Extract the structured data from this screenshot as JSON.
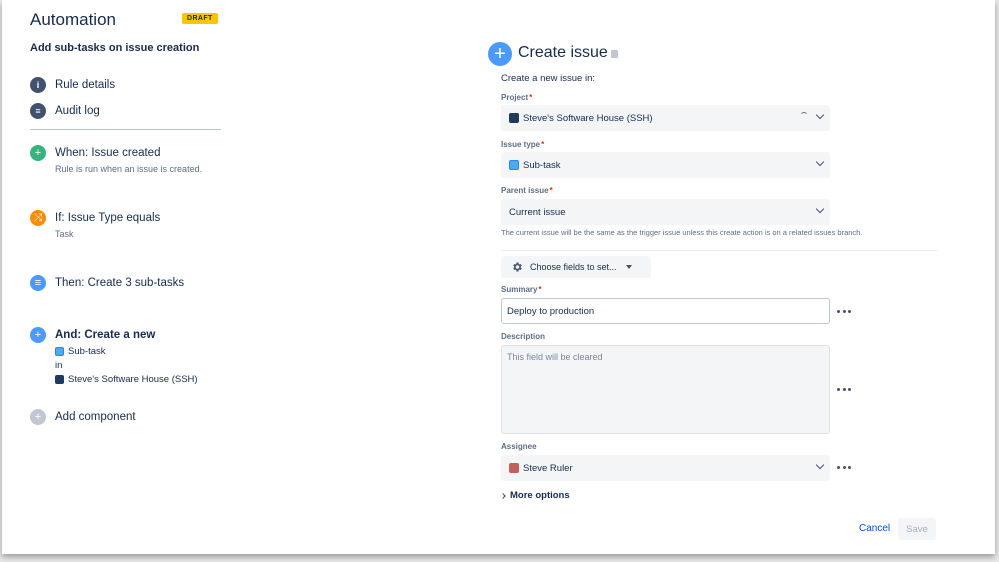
{
  "header": {
    "title": "Automation",
    "badge": "DRAFT"
  },
  "rule": {
    "name": "Add sub-tasks on issue creation"
  },
  "nav": {
    "rule_details": "Rule details",
    "audit_log": "Audit log"
  },
  "steps": {
    "when": {
      "title": "When: Issue created",
      "subtitle": "Rule is run when an issue is created."
    },
    "if": {
      "title": "If: Issue Type equals",
      "subtitle": "Task"
    },
    "then": {
      "title": "Then: Create 3 sub-tasks"
    },
    "and": {
      "title": "And: Create a new",
      "issue_type": "Sub-task",
      "in": "in",
      "project": "Steve's Software House (SSH)"
    },
    "add_component": "Add component"
  },
  "action": {
    "title": "Create issue",
    "create_in": "Create a new issue in:",
    "project": {
      "label": "Project",
      "value": "Steve's Software House (SSH)"
    },
    "issue_type": {
      "label": "Issue type",
      "value": "Sub-task"
    },
    "parent_issue": {
      "label": "Parent issue",
      "value": "Current issue",
      "helper": "The current issue will be the same as the trigger issue unless this create action is on a related issues branch."
    },
    "choose_fields": "Choose fields to set...",
    "summary": {
      "label": "Summary",
      "value": "Deploy to production"
    },
    "description": {
      "label": "Description",
      "placeholder": "This field will be cleared"
    },
    "assignee": {
      "label": "Assignee",
      "value": "Steve Ruler"
    },
    "required_mark": "*",
    "more_options": "More options",
    "cancel": "Cancel",
    "save": "Save"
  },
  "colors": {
    "accent": "#0052cc",
    "badge": "#ffc400",
    "trigger": "#36b37e",
    "condition": "#ff8b00",
    "action": "#4c9aff"
  }
}
